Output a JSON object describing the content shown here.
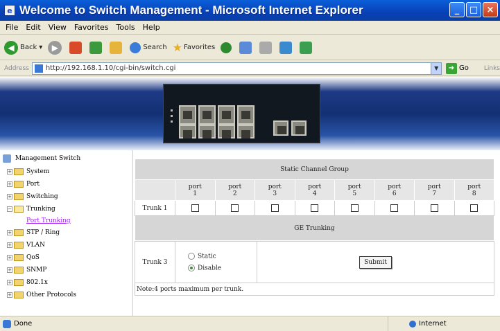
{
  "window": {
    "title": "Welcome to Switch Management - Microsoft Internet Explorer",
    "icon": "ie-page-icon",
    "controls": {
      "minimize": "_",
      "maximize": "□",
      "close": "×"
    }
  },
  "menu": {
    "items": [
      {
        "label": "File"
      },
      {
        "label": "Edit"
      },
      {
        "label": "View"
      },
      {
        "label": "Favorites"
      },
      {
        "label": "Tools"
      },
      {
        "label": "Help"
      }
    ]
  },
  "toolbar": {
    "back_label": "Back",
    "search_label": "Search",
    "favorites_label": "Favorites"
  },
  "address": {
    "label": "Address",
    "url": "http://192.168.1.10/cgi-bin/switch.cgi",
    "go_label": "Go",
    "links_label": "Links"
  },
  "tree": {
    "root_label": "Management Switch",
    "items": [
      {
        "label": "System"
      },
      {
        "label": "Port"
      },
      {
        "label": "Switching"
      },
      {
        "label": "Trunking"
      },
      {
        "label": "STP / Ring"
      },
      {
        "label": "VLAN"
      },
      {
        "label": "QoS"
      },
      {
        "label": "SNMP"
      },
      {
        "label": "802.1x"
      },
      {
        "label": "Other Protocols"
      }
    ],
    "sub_item": {
      "label": "Port Trunking"
    }
  },
  "static_group": {
    "heading": "Static Channel Group",
    "ports": [
      {
        "top": "port",
        "num": "1"
      },
      {
        "top": "port",
        "num": "2"
      },
      {
        "top": "port",
        "num": "3"
      },
      {
        "top": "port",
        "num": "4"
      },
      {
        "top": "port",
        "num": "5"
      },
      {
        "top": "port",
        "num": "6"
      },
      {
        "top": "port",
        "num": "7"
      },
      {
        "top": "port",
        "num": "8"
      }
    ],
    "row_label": "Trunk 1"
  },
  "ge_trunking": {
    "heading": "GE Trunking",
    "row_label": "Trunk 3",
    "options": [
      {
        "label": "Static",
        "selected": false
      },
      {
        "label": "Disable",
        "selected": true
      }
    ],
    "submit_label": "Submit"
  },
  "note": "Note:4 ports maximum per trunk.",
  "status": {
    "left": "Done",
    "zone": "Internet"
  }
}
